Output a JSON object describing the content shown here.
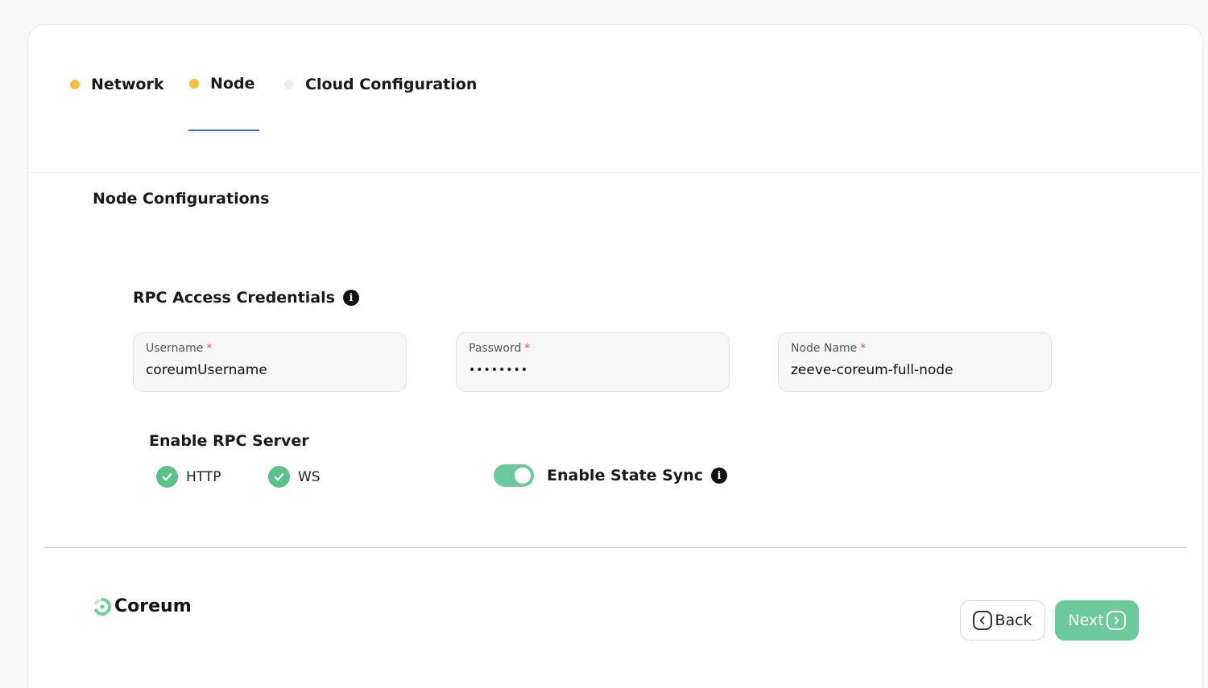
{
  "steps": [
    {
      "label": "Network",
      "state": "done"
    },
    {
      "label": "Node",
      "state": "active"
    },
    {
      "label": "Cloud Configuration",
      "state": "pending"
    }
  ],
  "section_title": "Node Configurations",
  "rpc": {
    "heading": "RPC Access Credentials",
    "info_icon": "info-icon"
  },
  "fields": {
    "username": {
      "label": "Username",
      "value": "coreumUsername"
    },
    "password": {
      "label": "Password",
      "value": "••••••••"
    },
    "node_name": {
      "label": "Node Name",
      "value": "zeeve-coreum-full-node"
    },
    "required_mark": "*"
  },
  "rpc_server": {
    "title": "Enable RPC Server",
    "options": [
      {
        "label": "HTTP",
        "checked": true
      },
      {
        "label": "WS",
        "checked": true
      }
    ]
  },
  "state_sync": {
    "label": "Enable State Sync",
    "enabled": true
  },
  "brand": {
    "name": "Coreum"
  },
  "buttons": {
    "back": "Back",
    "next": "Next"
  },
  "colors": {
    "accent_green": "#6cc99a",
    "step_done": "#f5c041",
    "tab_underline": "#2f6fd6",
    "required": "#e05a4f"
  }
}
